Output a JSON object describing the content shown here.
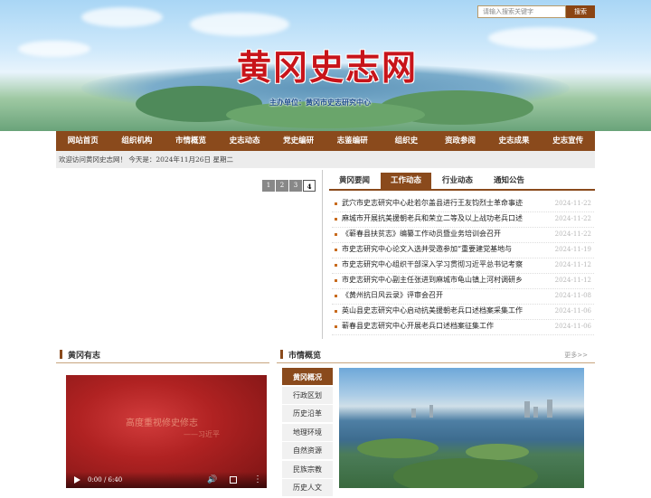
{
  "header": {
    "site_title": "黄冈史志网",
    "sponsor": "主办单位：黄冈市史志研究中心",
    "search_placeholder": "请输入搜索关键字",
    "search_button": "搜索"
  },
  "nav": [
    "网站首页",
    "组织机构",
    "市情概览",
    "史志动态",
    "党史编研",
    "志鉴编研",
    "组织史",
    "资政参阅",
    "史志成果",
    "史志宣传"
  ],
  "welcome": "欢迎访问黄冈史志网！ 今天是：2024年11月26日 星期二",
  "slider": {
    "pages": [
      "1",
      "2",
      "3",
      "4"
    ],
    "active_page": "4"
  },
  "news": {
    "tabs": [
      "黄冈要闻",
      "工作动态",
      "行业动态",
      "通知公告"
    ],
    "active_tab": "工作动态",
    "items": [
      {
        "title": "武穴市史志研究中心赴若尔盖县进行王友钧烈士革命事迹",
        "date": "2024-11-22"
      },
      {
        "title": "麻城市开展抗美援朝老兵和荣立二等及以上战功老兵口述",
        "date": "2024-11-22"
      },
      {
        "title": "《蕲春县扶贫志》编纂工作动员暨业务培训会召开",
        "date": "2024-11-22"
      },
      {
        "title": "市史志研究中心论文入选并受邀参加“重要建党基地与",
        "date": "2024-11-19"
      },
      {
        "title": "市史志研究中心组织干部深入学习贯彻习近平总书记考察",
        "date": "2024-11-12"
      },
      {
        "title": "市史志研究中心副主任张进到麻城市龟山镇上河村调研乡",
        "date": "2024-11-12"
      },
      {
        "title": "《黄州抗日风云录》评审会召开",
        "date": "2024-11-08"
      },
      {
        "title": "英山县史志研究中心启动抗美援朝老兵口述档案采集工作",
        "date": "2024-11-06"
      },
      {
        "title": "蕲春县史志研究中心开展老兵口述档案征集工作",
        "date": "2024-11-06"
      }
    ]
  },
  "left_section": {
    "title": "黄冈有志",
    "video": {
      "caption": "高度重视修史修志",
      "sub": "——习近平",
      "time": "0:00 / 6:40"
    }
  },
  "right_section": {
    "title": "市情概览",
    "more": "更多>>",
    "menu": [
      "黄冈概况",
      "行政区划",
      "历史沿革",
      "地理环境",
      "自然资源",
      "民族宗教",
      "历史人文"
    ],
    "active_menu": "黄冈概况"
  }
}
